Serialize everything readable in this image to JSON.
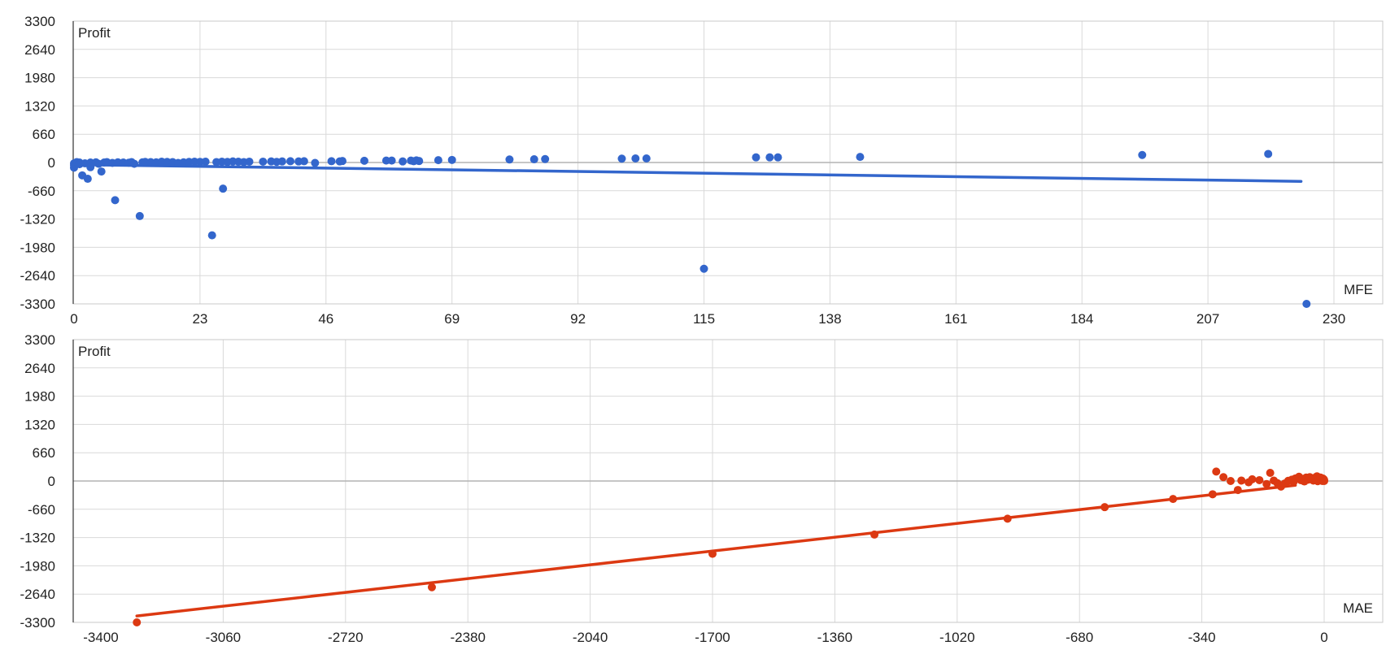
{
  "chart_data": [
    {
      "type": "scatter",
      "ylabel": "Profit",
      "xlabel": "MFE",
      "xlim": [
        0,
        230
      ],
      "ylim": [
        -3300,
        3300
      ],
      "x_ticks": [
        "0",
        "23",
        "46",
        "69",
        "92",
        "115",
        "138",
        "161",
        "184",
        "207",
        "230"
      ],
      "y_ticks": [
        "3300",
        "2640",
        "1980",
        "1320",
        "660",
        "0",
        "-660",
        "-1320",
        "-1980",
        "-2640",
        "-3300"
      ],
      "grid": true,
      "colors": {
        "point": "#3366cc",
        "trend": "#3366cc"
      },
      "series": [
        {
          "points": [
            [
              0,
              -20
            ],
            [
              0,
              -60
            ],
            [
              0,
              -120
            ],
            [
              0.5,
              10
            ],
            [
              1,
              0
            ],
            [
              1,
              -40
            ],
            [
              1.5,
              -300
            ],
            [
              2,
              -20
            ],
            [
              2.5,
              -380
            ],
            [
              3,
              0
            ],
            [
              3,
              -110
            ],
            [
              4,
              5
            ],
            [
              4.5,
              -30
            ],
            [
              5,
              -210
            ],
            [
              5.5,
              0
            ],
            [
              6,
              10
            ],
            [
              7,
              -10
            ],
            [
              7.5,
              -880
            ],
            [
              8,
              5
            ],
            [
              9,
              0
            ],
            [
              10,
              -5
            ],
            [
              10.5,
              10
            ],
            [
              11,
              -30
            ],
            [
              12,
              -1250
            ],
            [
              12.5,
              5
            ],
            [
              13,
              15
            ],
            [
              14,
              10
            ],
            [
              15,
              5
            ],
            [
              16,
              20
            ],
            [
              17,
              15
            ],
            [
              18,
              10
            ],
            [
              19,
              -10
            ],
            [
              20,
              5
            ],
            [
              21,
              15
            ],
            [
              22,
              20
            ],
            [
              23,
              15
            ],
            [
              24,
              20
            ],
            [
              25.2,
              -1700
            ],
            [
              26,
              10
            ],
            [
              27,
              20
            ],
            [
              27.2,
              -610
            ],
            [
              28,
              15
            ],
            [
              29,
              25
            ],
            [
              30,
              20
            ],
            [
              31,
              10
            ],
            [
              32,
              20
            ],
            [
              34.5,
              20
            ],
            [
              36,
              25
            ],
            [
              37,
              15
            ],
            [
              38,
              25
            ],
            [
              39.5,
              30
            ],
            [
              41,
              25
            ],
            [
              42,
              30
            ],
            [
              44,
              -10
            ],
            [
              47,
              30
            ],
            [
              48.5,
              25
            ],
            [
              49,
              35
            ],
            [
              53,
              40
            ],
            [
              57,
              45
            ],
            [
              58,
              45
            ],
            [
              60,
              25
            ],
            [
              61.5,
              45
            ],
            [
              62,
              30
            ],
            [
              62.5,
              50
            ],
            [
              63,
              35
            ],
            [
              66.5,
              55
            ],
            [
              69,
              60
            ],
            [
              79.5,
              70
            ],
            [
              84,
              75
            ],
            [
              86,
              80
            ],
            [
              100,
              90
            ],
            [
              102.5,
              95
            ],
            [
              104.5,
              95
            ],
            [
              115,
              -2480
            ],
            [
              124.5,
              120
            ],
            [
              127,
              120
            ],
            [
              128.5,
              120
            ],
            [
              143.5,
              130
            ],
            [
              195,
              175
            ],
            [
              218,
              200
            ],
            [
              225,
              -3300
            ]
          ],
          "trend": {
            "x": [
              0,
              224
            ],
            "y": [
              -50,
              -440
            ]
          }
        }
      ]
    },
    {
      "type": "scatter",
      "ylabel": "Profit",
      "xlabel": "MAE",
      "xlim": [
        -3400,
        0
      ],
      "ylim": [
        -3300,
        3300
      ],
      "x_ticks": [
        "-3400",
        "-3060",
        "-2720",
        "-2380",
        "-2040",
        "-1700",
        "-1360",
        "-1020",
        "-680",
        "-340",
        "0"
      ],
      "y_ticks": [
        "3300",
        "2640",
        "1980",
        "1320",
        "660",
        "0",
        "-660",
        "-1320",
        "-1980",
        "-2640",
        "-3300"
      ],
      "grid": true,
      "colors": {
        "point": "#dc3912",
        "trend": "#dc3912"
      },
      "series": [
        {
          "points": [
            [
              -3300,
              -3300
            ],
            [
              -2480,
              -2480
            ],
            [
              -1700,
              -1700
            ],
            [
              -1250,
              -1250
            ],
            [
              -880,
              -880
            ],
            [
              -610,
              -610
            ],
            [
              -420,
              -420
            ],
            [
              -310,
              -310
            ],
            [
              -300,
              220
            ],
            [
              -280,
              90
            ],
            [
              -260,
              0
            ],
            [
              -240,
              -210
            ],
            [
              -230,
              10
            ],
            [
              -210,
              -30
            ],
            [
              -200,
              40
            ],
            [
              -180,
              20
            ],
            [
              -160,
              -70
            ],
            [
              -150,
              190
            ],
            [
              -140,
              10
            ],
            [
              -130,
              -50
            ],
            [
              -120,
              -130
            ],
            [
              -110,
              -60
            ],
            [
              -100,
              5
            ],
            [
              -90,
              30
            ],
            [
              -85,
              -20
            ],
            [
              -80,
              60
            ],
            [
              -70,
              100
            ],
            [
              -65,
              20
            ],
            [
              -60,
              50
            ],
            [
              -55,
              -10
            ],
            [
              -50,
              80
            ],
            [
              -45,
              30
            ],
            [
              -40,
              90
            ],
            [
              -35,
              40
            ],
            [
              -30,
              10
            ],
            [
              -28,
              70
            ],
            [
              -25,
              55
            ],
            [
              -22,
              20
            ],
            [
              -20,
              110
            ],
            [
              -18,
              -5
            ],
            [
              -15,
              60
            ],
            [
              -12,
              35
            ],
            [
              -10,
              80
            ],
            [
              -8,
              15
            ],
            [
              -6,
              45
            ],
            [
              -5,
              0
            ],
            [
              -4,
              60
            ],
            [
              -3,
              25
            ],
            [
              -2,
              10
            ],
            [
              -1,
              40
            ],
            [
              0,
              20
            ],
            [
              0,
              0
            ]
          ],
          "trend": {
            "x": [
              -3300,
              -80
            ],
            "y": [
              -3150,
              -100
            ]
          }
        }
      ]
    }
  ]
}
